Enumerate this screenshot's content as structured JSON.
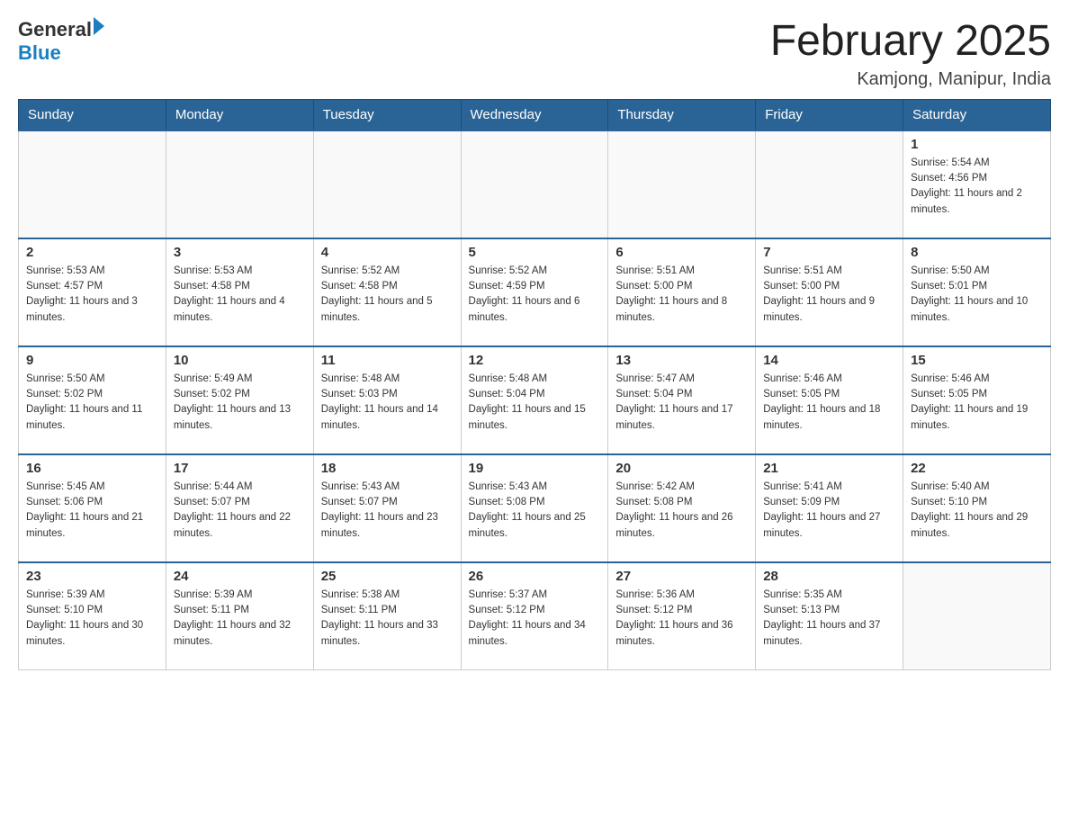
{
  "header": {
    "logo_general": "General",
    "logo_blue": "Blue",
    "month_title": "February 2025",
    "location": "Kamjong, Manipur, India"
  },
  "weekdays": [
    "Sunday",
    "Monday",
    "Tuesday",
    "Wednesday",
    "Thursday",
    "Friday",
    "Saturday"
  ],
  "weeks": [
    [
      {
        "day": "",
        "sunrise": "",
        "sunset": "",
        "daylight": ""
      },
      {
        "day": "",
        "sunrise": "",
        "sunset": "",
        "daylight": ""
      },
      {
        "day": "",
        "sunrise": "",
        "sunset": "",
        "daylight": ""
      },
      {
        "day": "",
        "sunrise": "",
        "sunset": "",
        "daylight": ""
      },
      {
        "day": "",
        "sunrise": "",
        "sunset": "",
        "daylight": ""
      },
      {
        "day": "",
        "sunrise": "",
        "sunset": "",
        "daylight": ""
      },
      {
        "day": "1",
        "sunrise": "Sunrise: 5:54 AM",
        "sunset": "Sunset: 4:56 PM",
        "daylight": "Daylight: 11 hours and 2 minutes."
      }
    ],
    [
      {
        "day": "2",
        "sunrise": "Sunrise: 5:53 AM",
        "sunset": "Sunset: 4:57 PM",
        "daylight": "Daylight: 11 hours and 3 minutes."
      },
      {
        "day": "3",
        "sunrise": "Sunrise: 5:53 AM",
        "sunset": "Sunset: 4:58 PM",
        "daylight": "Daylight: 11 hours and 4 minutes."
      },
      {
        "day": "4",
        "sunrise": "Sunrise: 5:52 AM",
        "sunset": "Sunset: 4:58 PM",
        "daylight": "Daylight: 11 hours and 5 minutes."
      },
      {
        "day": "5",
        "sunrise": "Sunrise: 5:52 AM",
        "sunset": "Sunset: 4:59 PM",
        "daylight": "Daylight: 11 hours and 6 minutes."
      },
      {
        "day": "6",
        "sunrise": "Sunrise: 5:51 AM",
        "sunset": "Sunset: 5:00 PM",
        "daylight": "Daylight: 11 hours and 8 minutes."
      },
      {
        "day": "7",
        "sunrise": "Sunrise: 5:51 AM",
        "sunset": "Sunset: 5:00 PM",
        "daylight": "Daylight: 11 hours and 9 minutes."
      },
      {
        "day": "8",
        "sunrise": "Sunrise: 5:50 AM",
        "sunset": "Sunset: 5:01 PM",
        "daylight": "Daylight: 11 hours and 10 minutes."
      }
    ],
    [
      {
        "day": "9",
        "sunrise": "Sunrise: 5:50 AM",
        "sunset": "Sunset: 5:02 PM",
        "daylight": "Daylight: 11 hours and 11 minutes."
      },
      {
        "day": "10",
        "sunrise": "Sunrise: 5:49 AM",
        "sunset": "Sunset: 5:02 PM",
        "daylight": "Daylight: 11 hours and 13 minutes."
      },
      {
        "day": "11",
        "sunrise": "Sunrise: 5:48 AM",
        "sunset": "Sunset: 5:03 PM",
        "daylight": "Daylight: 11 hours and 14 minutes."
      },
      {
        "day": "12",
        "sunrise": "Sunrise: 5:48 AM",
        "sunset": "Sunset: 5:04 PM",
        "daylight": "Daylight: 11 hours and 15 minutes."
      },
      {
        "day": "13",
        "sunrise": "Sunrise: 5:47 AM",
        "sunset": "Sunset: 5:04 PM",
        "daylight": "Daylight: 11 hours and 17 minutes."
      },
      {
        "day": "14",
        "sunrise": "Sunrise: 5:46 AM",
        "sunset": "Sunset: 5:05 PM",
        "daylight": "Daylight: 11 hours and 18 minutes."
      },
      {
        "day": "15",
        "sunrise": "Sunrise: 5:46 AM",
        "sunset": "Sunset: 5:05 PM",
        "daylight": "Daylight: 11 hours and 19 minutes."
      }
    ],
    [
      {
        "day": "16",
        "sunrise": "Sunrise: 5:45 AM",
        "sunset": "Sunset: 5:06 PM",
        "daylight": "Daylight: 11 hours and 21 minutes."
      },
      {
        "day": "17",
        "sunrise": "Sunrise: 5:44 AM",
        "sunset": "Sunset: 5:07 PM",
        "daylight": "Daylight: 11 hours and 22 minutes."
      },
      {
        "day": "18",
        "sunrise": "Sunrise: 5:43 AM",
        "sunset": "Sunset: 5:07 PM",
        "daylight": "Daylight: 11 hours and 23 minutes."
      },
      {
        "day": "19",
        "sunrise": "Sunrise: 5:43 AM",
        "sunset": "Sunset: 5:08 PM",
        "daylight": "Daylight: 11 hours and 25 minutes."
      },
      {
        "day": "20",
        "sunrise": "Sunrise: 5:42 AM",
        "sunset": "Sunset: 5:08 PM",
        "daylight": "Daylight: 11 hours and 26 minutes."
      },
      {
        "day": "21",
        "sunrise": "Sunrise: 5:41 AM",
        "sunset": "Sunset: 5:09 PM",
        "daylight": "Daylight: 11 hours and 27 minutes."
      },
      {
        "day": "22",
        "sunrise": "Sunrise: 5:40 AM",
        "sunset": "Sunset: 5:10 PM",
        "daylight": "Daylight: 11 hours and 29 minutes."
      }
    ],
    [
      {
        "day": "23",
        "sunrise": "Sunrise: 5:39 AM",
        "sunset": "Sunset: 5:10 PM",
        "daylight": "Daylight: 11 hours and 30 minutes."
      },
      {
        "day": "24",
        "sunrise": "Sunrise: 5:39 AM",
        "sunset": "Sunset: 5:11 PM",
        "daylight": "Daylight: 11 hours and 32 minutes."
      },
      {
        "day": "25",
        "sunrise": "Sunrise: 5:38 AM",
        "sunset": "Sunset: 5:11 PM",
        "daylight": "Daylight: 11 hours and 33 minutes."
      },
      {
        "day": "26",
        "sunrise": "Sunrise: 5:37 AM",
        "sunset": "Sunset: 5:12 PM",
        "daylight": "Daylight: 11 hours and 34 minutes."
      },
      {
        "day": "27",
        "sunrise": "Sunrise: 5:36 AM",
        "sunset": "Sunset: 5:12 PM",
        "daylight": "Daylight: 11 hours and 36 minutes."
      },
      {
        "day": "28",
        "sunrise": "Sunrise: 5:35 AM",
        "sunset": "Sunset: 5:13 PM",
        "daylight": "Daylight: 11 hours and 37 minutes."
      },
      {
        "day": "",
        "sunrise": "",
        "sunset": "",
        "daylight": ""
      }
    ]
  ]
}
